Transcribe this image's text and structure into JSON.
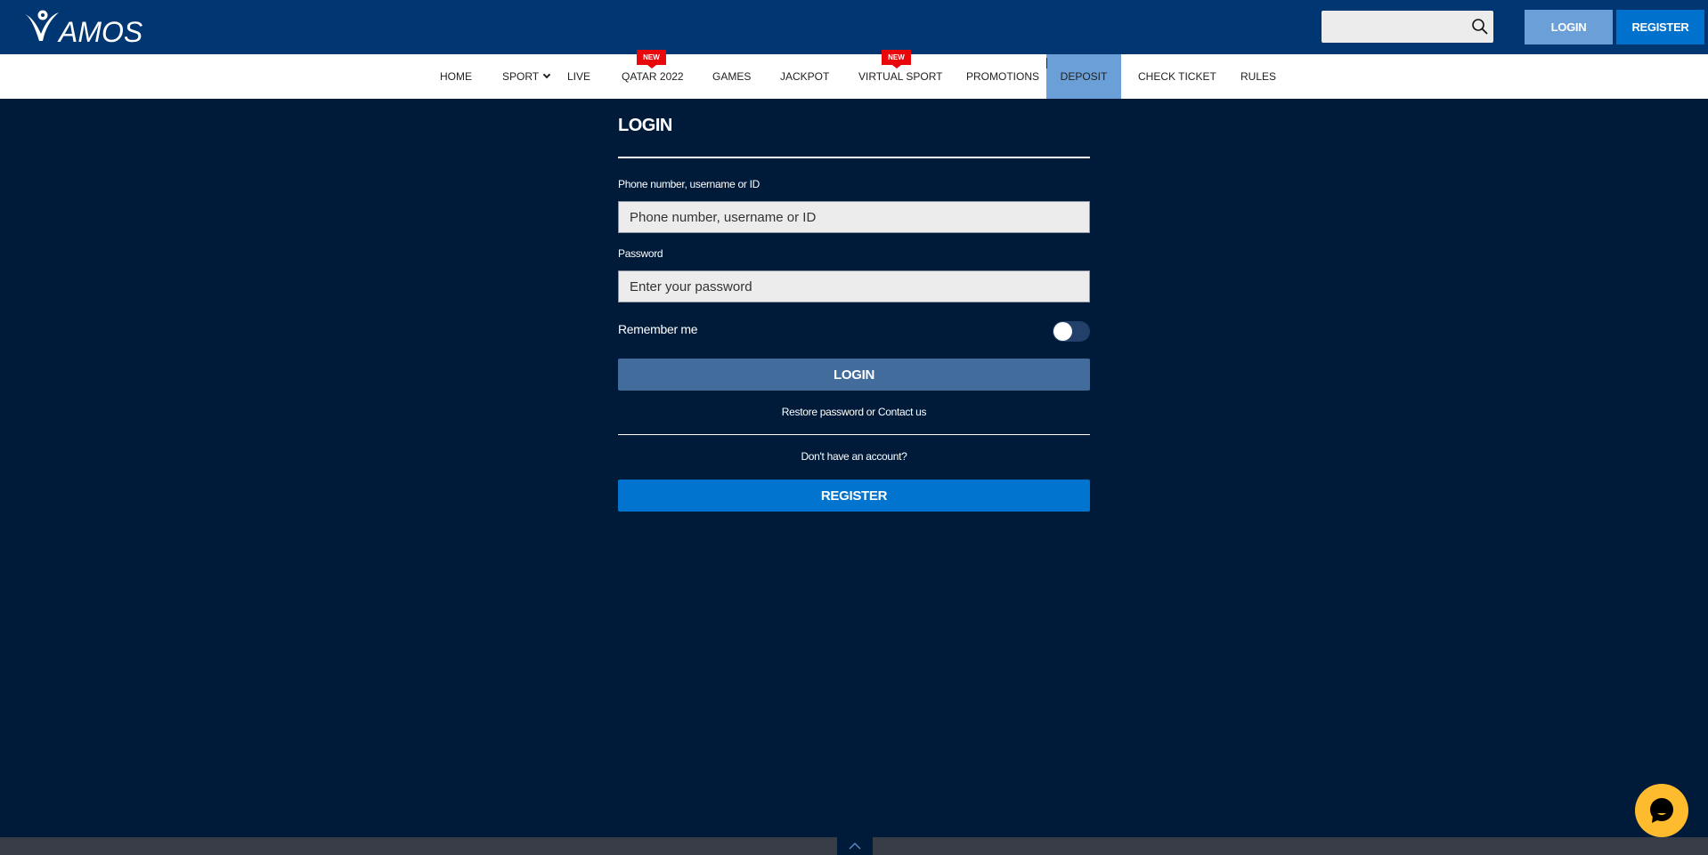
{
  "header": {
    "logo_text": "AMOS",
    "brand_name": "VAMOS",
    "search": {
      "value": "",
      "placeholder": "",
      "icon": "search-icon"
    },
    "login_label": "LOGIN",
    "register_label": "REGISTER"
  },
  "nav": {
    "items": [
      {
        "label": "HOME"
      },
      {
        "label": "SPORT",
        "has_dropdown": true
      },
      {
        "label": "LIVE"
      },
      {
        "label": "QATAR 2022",
        "badge": "NEW"
      },
      {
        "label": "GAMES"
      },
      {
        "label": "JACKPOT"
      },
      {
        "label": "VIRTUAL SPORT",
        "badge": "NEW"
      },
      {
        "label": "PROMOTIONS"
      },
      {
        "label": "DEPOSIT",
        "active": true
      },
      {
        "label": "CHECK TICKET"
      },
      {
        "label": "RULES"
      }
    ]
  },
  "login_form": {
    "title": "LOGIN",
    "username_label": "Phone number, username or ID",
    "username_placeholder": "Phone number, username or ID",
    "username_value": "",
    "password_label": "Password",
    "password_placeholder": "Enter your password",
    "password_value": "",
    "remember_label": "Remember me",
    "remember_checked": false,
    "login_button": "LOGIN",
    "restore_link": "Restore password",
    "or_text": " or ",
    "contact_link": "Contact us",
    "no_account_text": "Don't have an account?",
    "register_button": "REGISTER"
  },
  "colors": {
    "header_bg": "#003672",
    "page_bg": "#001b3a",
    "active_nav": "#6a9fd8",
    "badge": "#e8070b",
    "login_btn": "#426c9c",
    "register_btn": "#0074cf",
    "chat": "#fdbb2d"
  },
  "chat": {
    "icon": "chat-bubble-icon"
  },
  "footer": {
    "icon": "chevron-up-icon"
  }
}
